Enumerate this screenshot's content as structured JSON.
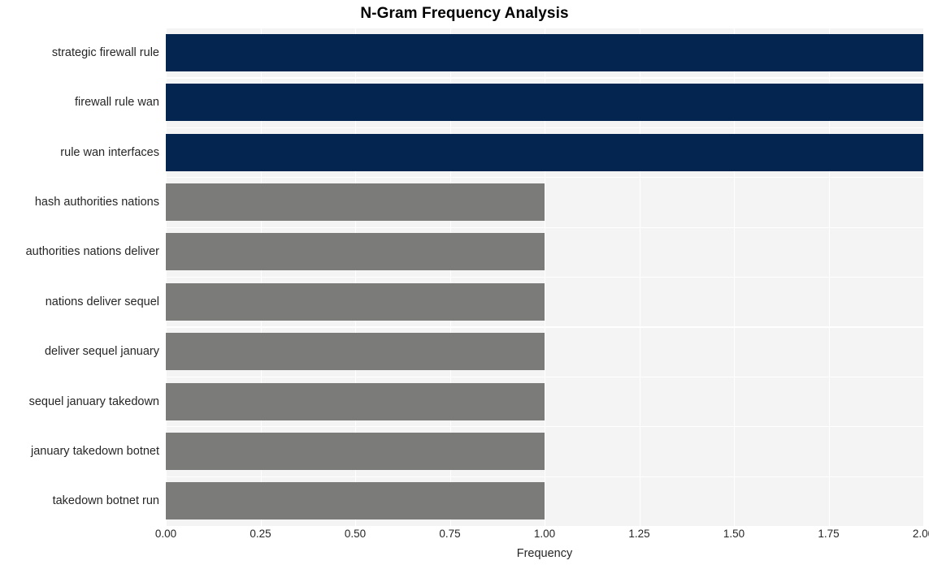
{
  "chart_data": {
    "type": "bar",
    "orientation": "horizontal",
    "title": "N-Gram Frequency Analysis",
    "xlabel": "Frequency",
    "ylabel": "",
    "xlim": [
      0,
      2.0
    ],
    "grid": true,
    "legend": null,
    "categories": [
      "strategic firewall rule",
      "firewall rule wan",
      "rule wan interfaces",
      "hash authorities nations",
      "authorities nations deliver",
      "nations deliver sequel",
      "deliver sequel january",
      "sequel january takedown",
      "january takedown botnet",
      "takedown botnet run"
    ],
    "values": [
      2,
      2,
      2,
      1,
      1,
      1,
      1,
      1,
      1,
      1
    ],
    "bar_colors": [
      "#04254f",
      "#04254f",
      "#04254f",
      "#7b7b79",
      "#7b7b79",
      "#7b7b79",
      "#7b7b79",
      "#7b7b79",
      "#7b7b79",
      "#7b7b79"
    ],
    "xticks": [
      "0.00",
      "0.25",
      "0.50",
      "0.75",
      "1.00",
      "1.25",
      "1.50",
      "1.75",
      "2.00"
    ],
    "xtick_values": [
      0,
      0.25,
      0.5,
      0.75,
      1.0,
      1.25,
      1.5,
      1.75,
      2.0
    ],
    "colors": {
      "plot_background": "#f4f4f4",
      "figure_background": "#ffffff",
      "gridline": "#ffffff",
      "text": "#262626",
      "title": "#000000",
      "high_bar": "#04254f",
      "low_bar": "#7b7b79"
    }
  }
}
